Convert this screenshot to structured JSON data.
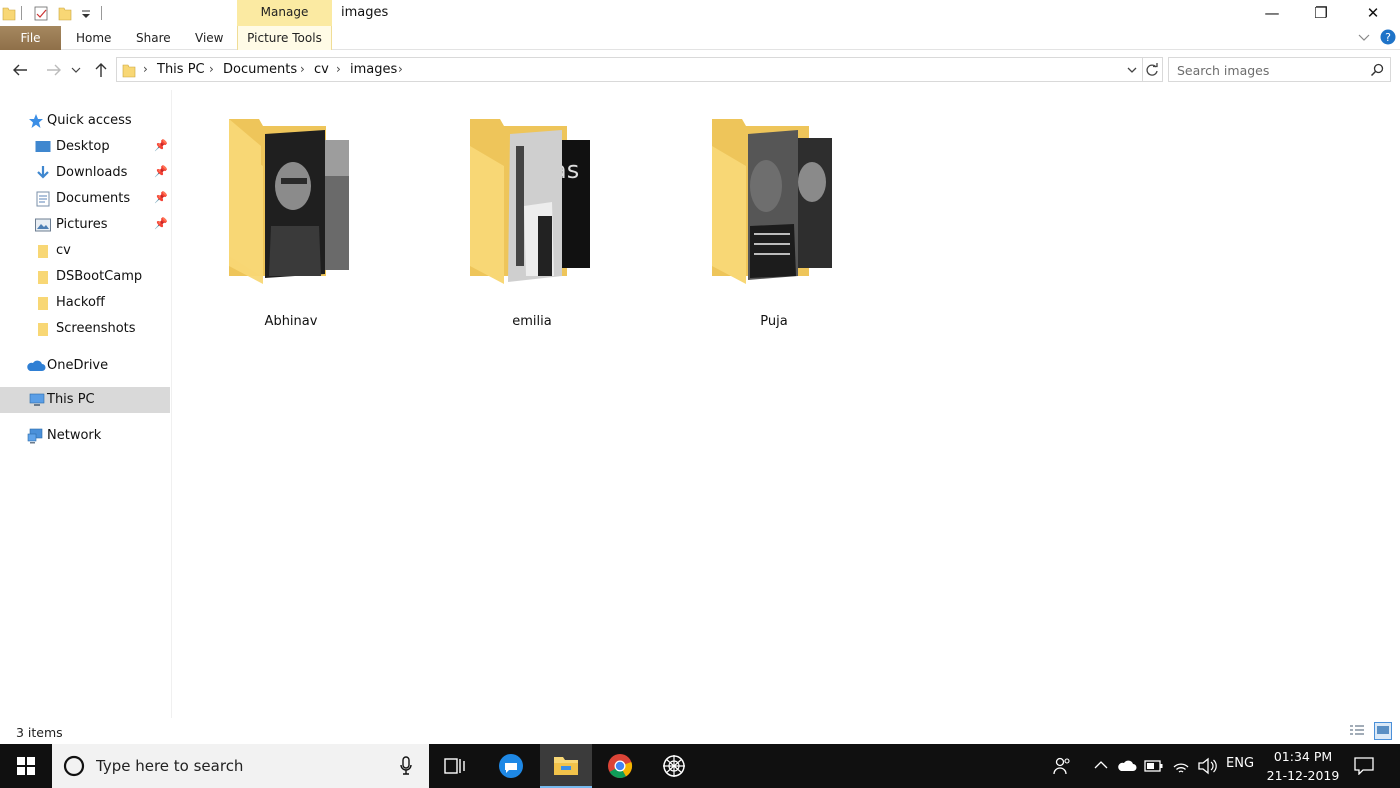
{
  "titlebar": {
    "title": "images",
    "contextual_tab": "Manage",
    "minimize": "—",
    "restore": "❐",
    "close": "✕"
  },
  "ribbon": {
    "tabs": [
      "File",
      "Home",
      "Share",
      "View",
      "Picture Tools"
    ]
  },
  "address": {
    "breadcrumbs": [
      "This PC",
      "Documents",
      "cv",
      "images"
    ]
  },
  "search": {
    "placeholder": "Search images"
  },
  "navpane": {
    "quick_access": "Quick access",
    "pinned": [
      "Desktop",
      "Downloads",
      "Documents",
      "Pictures"
    ],
    "folders": [
      "cv",
      "DSBootCamp",
      "Hackoff",
      "Screenshots"
    ],
    "onedrive": "OneDrive",
    "thispc": "This PC",
    "network": "Network"
  },
  "content": {
    "folders": [
      "Abhinav",
      "emilia",
      "Puja"
    ]
  },
  "status": {
    "count": "3 items"
  },
  "taskbar": {
    "search_placeholder": "Type here to search",
    "language": "ENG",
    "time": "01:34 PM",
    "date": "21-12-2019"
  },
  "colors": {
    "file_tab": "#9a7b53",
    "manage_tab": "#fbeaa2",
    "folder_yellow": "#f8d775",
    "selection": "#d9d9d9",
    "taskbar": "#101010"
  }
}
